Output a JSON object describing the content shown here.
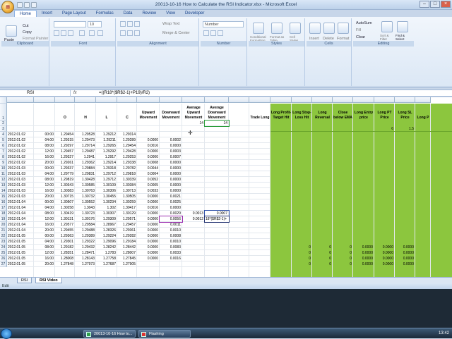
{
  "window": {
    "title": "20013-10-16 How to Calculate the RSI Indicator.xlsx - Microsoft Excel"
  },
  "ribbon_tabs": [
    "Home",
    "Insert",
    "Page Layout",
    "Formulas",
    "Data",
    "Review",
    "View",
    "Developer"
  ],
  "ribbon": {
    "clipboard": {
      "label": "Clipboard",
      "paste": "Paste",
      "cut": "Cut",
      "copy": "Copy",
      "format_painter": "Format Painter"
    },
    "font": {
      "label": "Font",
      "font_name": "",
      "font_size": "10"
    },
    "alignment": {
      "label": "Alignment",
      "wrap": "Wrap Text",
      "merge": "Merge & Center"
    },
    "number": {
      "label": "Number",
      "format": "Number"
    },
    "styles": {
      "label": "Styles",
      "cond": "Conditional Formatting",
      "table": "Format as Table",
      "cell": "Cell Styles"
    },
    "cells": {
      "label": "Cells",
      "insert": "Insert",
      "delete": "Delete",
      "format": "Format"
    },
    "editing": {
      "label": "Editing",
      "autosum": "AutoSum",
      "fill": "Fill",
      "clear": "Clear",
      "sort": "Sort & Filter",
      "find": "Find & Select"
    }
  },
  "formula_bar": {
    "name_box": "RSI",
    "fx": "fx",
    "formula": "=((R18*($R$2-1)+P19)/R2)"
  },
  "columns": [
    {
      "id": "A",
      "w": 38
    },
    {
      "id": "B",
      "w": 30
    },
    {
      "id": "C",
      "w": 28
    },
    {
      "id": "D",
      "w": 30
    },
    {
      "id": "E",
      "w": 30
    },
    {
      "id": "F",
      "w": 28
    },
    {
      "id": "O",
      "w": 32
    },
    {
      "id": "P",
      "w": 32
    },
    {
      "id": "Q",
      "w": 32
    },
    {
      "id": "R",
      "w": 34
    },
    {
      "id": "S",
      "w": 29
    },
    {
      "id": "U",
      "w": 30
    },
    {
      "id": "V",
      "w": 30
    },
    {
      "id": "W",
      "w": 29
    },
    {
      "id": "X",
      "w": 29
    },
    {
      "id": "Y",
      "w": 29
    },
    {
      "id": "Z",
      "w": 30
    },
    {
      "id": "AA",
      "w": 29
    },
    {
      "id": "AB",
      "w": 29
    },
    {
      "id": "AC",
      "w": 22
    }
  ],
  "header_row": [
    "",
    "",
    "O",
    "H",
    "L",
    "C",
    "Upward Movement",
    "Downward Movement",
    "Average Upward Movement",
    "Average Downward Movement",
    "",
    "Trade Long",
    "Long Profit-Target Hit",
    "Long Stop-Loss Hit",
    "Long Reversal",
    "Close below EMA",
    "Long Entry price",
    "Long PT Price",
    "Long SL Price",
    "Long P"
  ],
  "row2": {
    "Q": "14",
    "R": "14"
  },
  "row3": {
    "AA": "6",
    "AB": "1.5"
  },
  "rows": [
    {
      "n": "4",
      "date": "2012.01.02",
      "time": "00:00",
      "o": "1.29454",
      "h": "1.29528",
      "l": "1.29212",
      "c": "1.29314",
      "p": "",
      "q": "",
      "r": "",
      "s": ""
    },
    {
      "n": "5",
      "date": "2012.01.02",
      "time": "04:00",
      "o": "1.29315",
      "h": "1.29473",
      "l": "1.29211",
      "c": "1.29289",
      "p": "0.0000",
      "q": "0.0002",
      "r": "",
      "s": ""
    },
    {
      "n": "6",
      "date": "2012.01.02",
      "time": "08:00",
      "o": "1.29297",
      "h": "1.29714",
      "l": "1.29265",
      "c": "1.29454",
      "p": "0.0016",
      "q": "0.0000",
      "r": "",
      "s": ""
    },
    {
      "n": "7",
      "date": "2012.01.02",
      "time": "12:00",
      "o": "1.29457",
      "h": "1.29487",
      "l": "1.29292",
      "c": "1.29428",
      "p": "0.0000",
      "q": "0.0003",
      "r": "",
      "s": ""
    },
    {
      "n": "8",
      "date": "2012.01.02",
      "time": "16:00",
      "o": "1.29327",
      "h": "1.2941",
      "l": "1.2917",
      "c": "1.29253",
      "p": "0.0000",
      "q": "0.0007",
      "r": "",
      "s": ""
    },
    {
      "n": "9",
      "date": "2012.01.02",
      "time": "20:00",
      "o": "1.29261",
      "h": "1.29362",
      "l": "1.29214",
      "c": "1.29338",
      "p": "0.0008",
      "q": "0.0000",
      "r": "",
      "s": ""
    },
    {
      "n": "10",
      "date": "2012.01.03",
      "time": "00:00",
      "o": "1.29337",
      "h": "1.29884",
      "l": "1.29318",
      "c": "1.29782",
      "p": "0.0044",
      "q": "0.0000",
      "r": "",
      "s": ""
    },
    {
      "n": "11",
      "date": "2012.01.03",
      "time": "04:00",
      "o": "1.29779",
      "h": "1.29831",
      "l": "1.29712",
      "c": "1.29818",
      "p": "0.0004",
      "q": "0.0000",
      "r": "",
      "s": ""
    },
    {
      "n": "12",
      "date": "2012.01.03",
      "time": "08:00",
      "o": "1.29819",
      "h": "1.30428",
      "l": "1.29712",
      "c": "1.30339",
      "p": "0.0052",
      "q": "0.0000",
      "r": "",
      "s": ""
    },
    {
      "n": "13",
      "date": "2012.01.03",
      "time": "12:00",
      "o": "1.30343",
      "h": "1.30585",
      "l": "1.30109",
      "c": "1.30384",
      "p": "0.0005",
      "q": "0.0000",
      "r": "",
      "s": ""
    },
    {
      "n": "14",
      "date": "2012.01.03",
      "time": "16:00",
      "o": "1.30383",
      "h": "1.30763",
      "l": "1.30306",
      "c": "1.30713",
      "p": "0.0033",
      "q": "0.0000",
      "r": "",
      "s": ""
    },
    {
      "n": "15",
      "date": "2012.01.03",
      "time": "20:00",
      "o": "1.30715",
      "h": "1.30732",
      "l": "1.30455",
      "c": "1.30505",
      "p": "0.0000",
      "q": "0.0021",
      "r": "",
      "s": ""
    },
    {
      "n": "16",
      "date": "2012.01.04",
      "time": "00:00",
      "o": "1.30507",
      "h": "1.30552",
      "l": "1.30234",
      "c": "1.30259",
      "p": "0.0000",
      "q": "0.0025",
      "r": "",
      "s": ""
    },
    {
      "n": "17",
      "date": "2012.01.04",
      "time": "04:00",
      "o": "1.30258",
      "h": "1.3043",
      "l": "1.302",
      "c": "1.30417",
      "p": "0.0016",
      "q": "0.0000",
      "r": "",
      "s": ""
    },
    {
      "n": "18",
      "date": "2012.01.04",
      "time": "08:00",
      "o": "1.30419",
      "h": "1.30723",
      "l": "1.30307",
      "c": "1.30129",
      "p": "0.0000",
      "q": "0.0029",
      "r": "0.0013",
      "s": "0.0007"
    },
    {
      "n": "19",
      "date": "2012.01.04",
      "time": "12:00",
      "o": "1.30131",
      "h": "1.30176",
      "l": "1.29309",
      "c": "1.29571",
      "p": "0.0000",
      "q": "0.0056",
      "r": "0.0012",
      "s": "18*($R$2-1)+"
    },
    {
      "n": "20",
      "date": "2012.01.04",
      "time": "16:00",
      "o": "1.29577",
      "h": "1.29584",
      "l": "1.28967",
      "c": "1.29457",
      "p": "0.0000",
      "q": "0.0011",
      "r": "",
      "s": ""
    },
    {
      "n": "21",
      "date": "2012.01.04",
      "time": "20:00",
      "o": "1.29455",
      "h": "1.29488",
      "l": "1.28326",
      "c": "1.29361",
      "p": "0.0000",
      "q": "0.0010",
      "r": "",
      "s": ""
    },
    {
      "n": "22",
      "date": "2012.01.05",
      "time": "00:00",
      "o": "1.29363",
      "h": "1.29389",
      "l": "1.29224",
      "c": "1.29282",
      "p": "0.0000",
      "q": "0.0008",
      "r": "",
      "s": ""
    },
    {
      "n": "23",
      "date": "2012.01.05",
      "time": "04:00",
      "o": "1.29301",
      "h": "1.29322",
      "l": "1.29096",
      "c": "1.29184",
      "p": "0.0000",
      "q": "0.0010",
      "r": "",
      "s": ""
    },
    {
      "n": "24",
      "date": "2012.01.05",
      "time": "08:00",
      "o": "1.29182",
      "h": "1.29432",
      "l": "1.28242",
      "c": "1.28442",
      "p": "0.0000",
      "q": "0.0083",
      "r": "",
      "s": ""
    },
    {
      "n": "25",
      "date": "2012.01.05",
      "time": "12:00",
      "o": "1.28351",
      "h": "1.28471",
      "l": "1.2783",
      "c": "1.28007",
      "p": "0.0000",
      "q": "0.0033",
      "r": "",
      "s": ""
    },
    {
      "n": "26",
      "date": "2012.01.05",
      "time": "16:00",
      "o": "1.28008",
      "h": "1.28143",
      "l": "1.27758",
      "c": "1.27845",
      "p": "0.0000",
      "q": "0.0016",
      "r": "",
      "s": ""
    },
    {
      "n": "27",
      "date": "2012.01.05",
      "time": "20:00",
      "o": "1.27848",
      "h": "1.27973",
      "l": "1.27687",
      "c": "1.27905",
      "p": "",
      "q": "",
      "r": "",
      "s": ""
    }
  ],
  "green_values": [
    {
      "row": "24",
      "w": "0",
      "x": "0",
      "y": "0",
      "aa": "0.0000",
      "ab": "0.0000",
      "ac": "0.0000"
    },
    {
      "row": "25",
      "w": "0",
      "x": "0",
      "y": "0",
      "aa": "0.0000",
      "ab": "0.0000",
      "ac": "0.0000"
    },
    {
      "row": "26",
      "w": "0",
      "x": "0",
      "y": "0",
      "aa": "0.0000",
      "ab": "0.0000",
      "ac": "0.0000"
    },
    {
      "row": "27",
      "w": "0",
      "x": "0",
      "y": "0",
      "aa": "0.0000",
      "ab": "0.0000",
      "ac": "0.0000"
    }
  ],
  "sheets": [
    "RSI",
    "RSI Video"
  ],
  "active_sheet": "RSI Video",
  "status": "Edit",
  "taskbar": {
    "items": [
      "20013-10-16 How to...",
      "Flashing"
    ],
    "clock": "13:42"
  },
  "colors": {
    "green_block": "#8cc63e",
    "ribbon": "#dbe7f5",
    "selection": "#1f2f6f"
  }
}
